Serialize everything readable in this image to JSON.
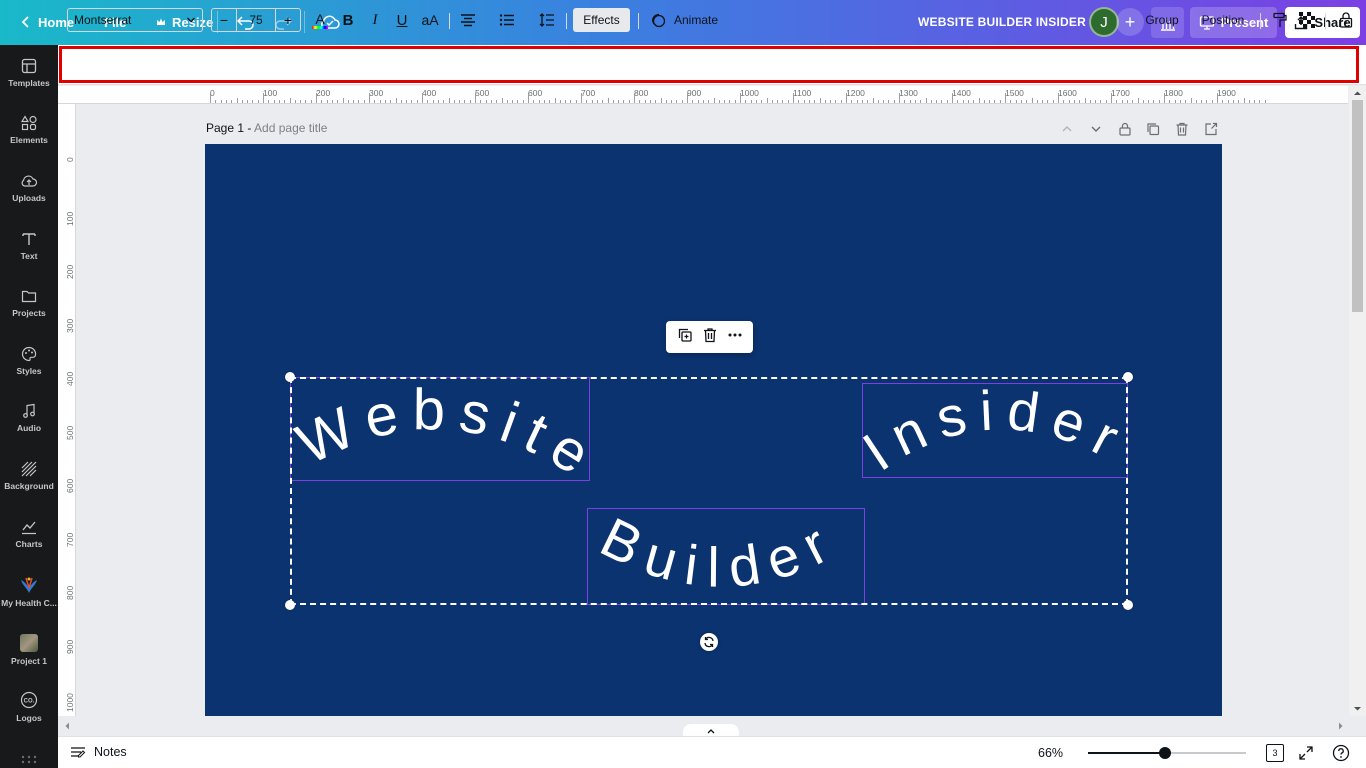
{
  "topbar": {
    "home_label": "Home",
    "file_label": "File",
    "resize_label": "Resize",
    "doc_title": "WEBSITE BUILDER INSIDER",
    "avatar_initial": "J",
    "present_label": "Present",
    "share_label": "Share"
  },
  "sidebar": {
    "items": [
      {
        "label": "Templates",
        "icon": "templates-icon"
      },
      {
        "label": "Elements",
        "icon": "elements-icon"
      },
      {
        "label": "Uploads",
        "icon": "uploads-icon"
      },
      {
        "label": "Text",
        "icon": "text-icon"
      },
      {
        "label": "Projects",
        "icon": "projects-icon"
      },
      {
        "label": "Styles",
        "icon": "styles-icon"
      },
      {
        "label": "Audio",
        "icon": "audio-icon"
      },
      {
        "label": "Background",
        "icon": "background-icon"
      },
      {
        "label": "Charts",
        "icon": "charts-icon"
      },
      {
        "label": "My Health C...",
        "icon": "app-thumbnail"
      },
      {
        "label": "Project 1",
        "icon": "project-thumbnail"
      },
      {
        "label": "Logos",
        "icon": "logos-icon"
      }
    ]
  },
  "toolbar": {
    "font": "Montserrat",
    "font_size": "75",
    "minus_label": "−",
    "plus_label": "+",
    "bold_label": "B",
    "italic_label": "I",
    "underline_label": "U",
    "case_label": "aA",
    "effects_label": "Effects",
    "animate_label": "Animate",
    "group_label": "Group",
    "position_label": "Position"
  },
  "ruler": {
    "top_labels": [
      "0",
      "100",
      "200",
      "300",
      "400",
      "500",
      "600",
      "700",
      "800",
      "900",
      "1000",
      "1100",
      "1200",
      "1300",
      "1400",
      "1500",
      "1600",
      "1700",
      "1800",
      "1900"
    ],
    "left_labels": [
      "0",
      "100",
      "200",
      "300",
      "400",
      "500",
      "600",
      "700",
      "800",
      "900",
      "1000"
    ]
  },
  "page": {
    "title": "Page 1 -",
    "subtitle_placeholder": "Add page title",
    "background_color": "#0b3370"
  },
  "canvas_text": {
    "word1": "Website",
    "word2": "Insider",
    "word3": "Builder",
    "selection_color": "#7b3fe4"
  },
  "bottombar": {
    "notes_label": "Notes",
    "zoom": "66%",
    "zoom_fraction": 0.49,
    "page_count": "3"
  }
}
